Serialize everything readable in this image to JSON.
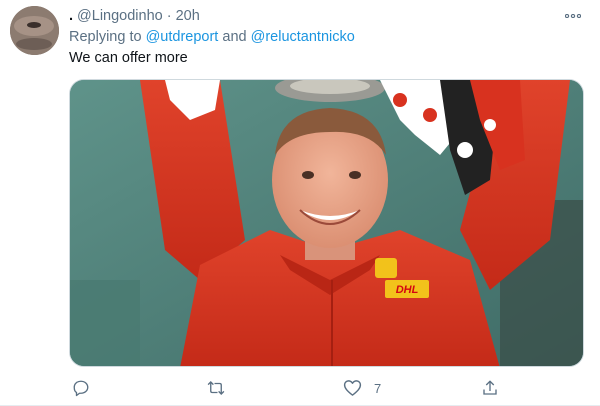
{
  "tweet": {
    "display_name": ".",
    "handle": "@Lingodinho",
    "separator": "·",
    "time": "20h",
    "replying_prefix": "Replying to",
    "mentions": [
      "@utdreport",
      "@reluctantnicko"
    ],
    "mention_joiner": "and",
    "text": "We can offer more"
  },
  "media": {
    "sign_text": "DHL",
    "description_colors": {
      "background": "#5a8a82",
      "kit": "#d8321f",
      "sponsor": "#f2c21b"
    }
  },
  "actions": {
    "reply_icon": "reply-icon",
    "retweet_icon": "retweet-icon",
    "like_icon": "heart-icon",
    "like_count": "7",
    "share_icon": "share-icon"
  },
  "colors": {
    "text_primary": "#0f1419",
    "text_secondary": "#5b7083",
    "link": "#1b95e0"
  }
}
